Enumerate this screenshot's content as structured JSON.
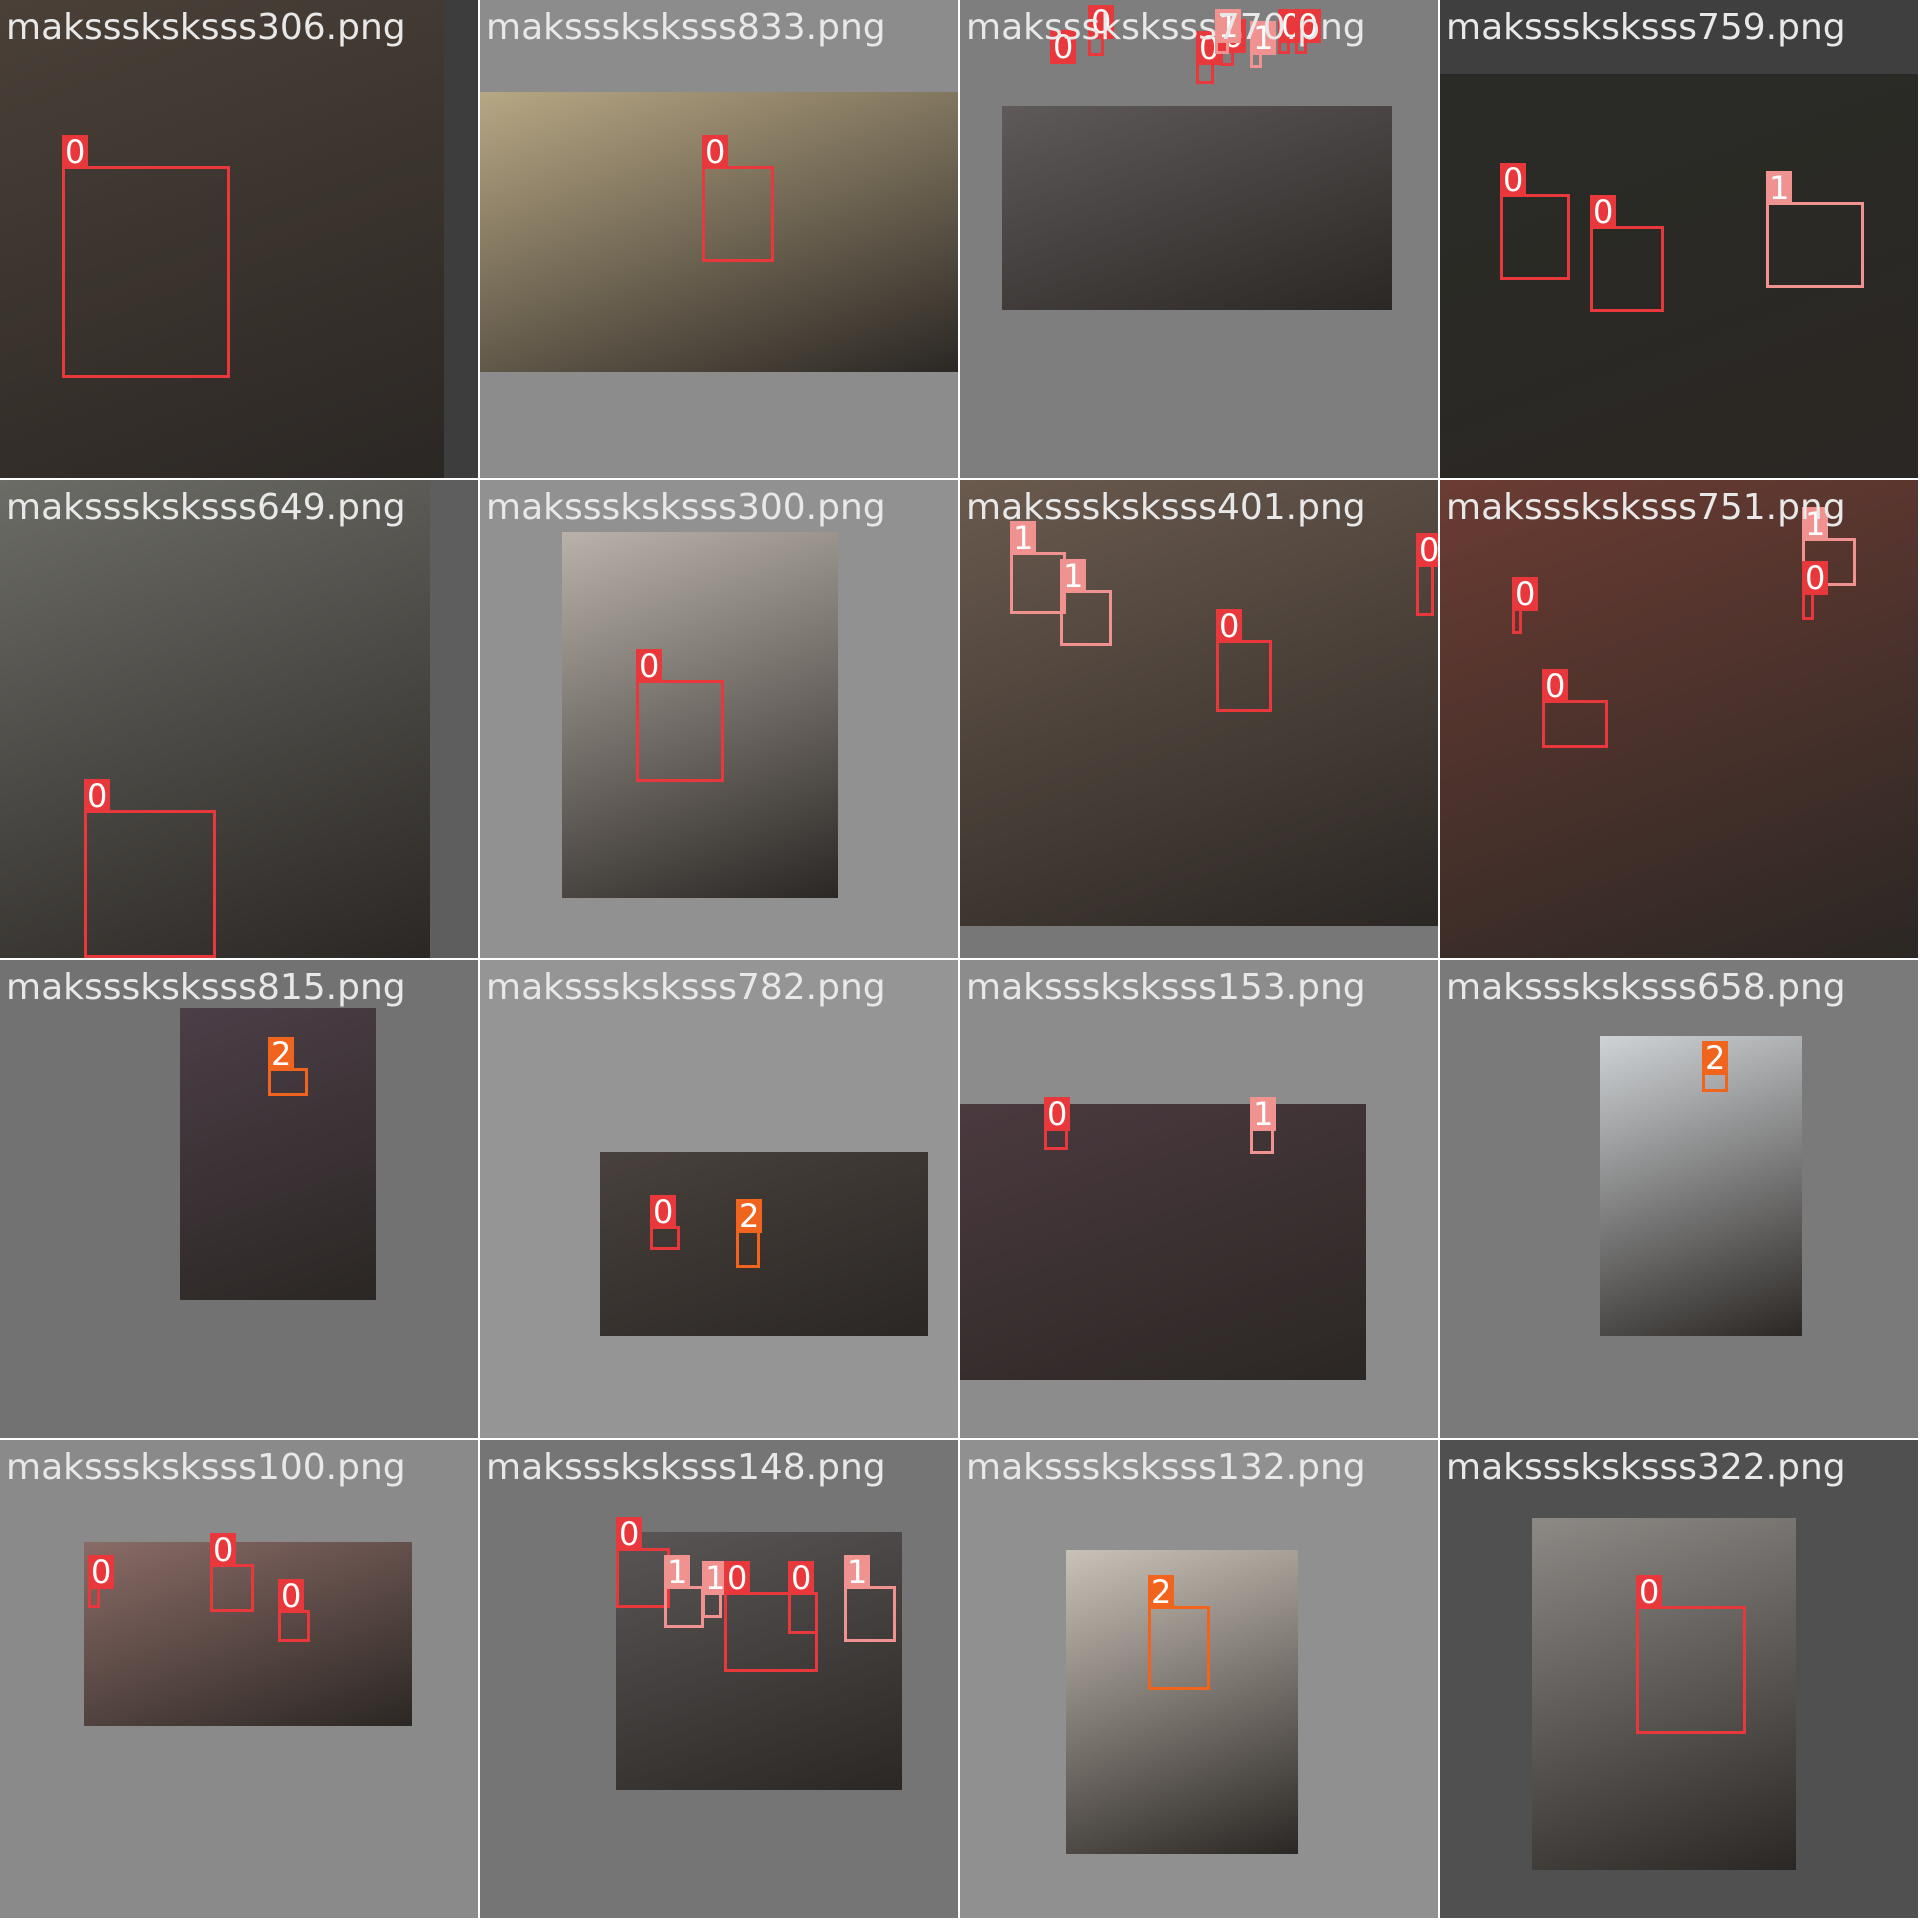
{
  "grid": {
    "columns": 4,
    "rows": 4
  },
  "class_colors": {
    "0": "#e8383b",
    "1": "#f0928f",
    "2": "#f0641e"
  },
  "tiles": [
    {
      "filename": "maksssksksss306.png",
      "bg": "#3d3d3d",
      "photo_color": "#4a4038",
      "boxes": [
        {
          "label": "0"
        }
      ]
    },
    {
      "filename": "maksssksksss833.png",
      "bg": "#8c8c8c",
      "photo_color": "#b7a784",
      "boxes": [
        {
          "label": "0"
        }
      ]
    },
    {
      "filename": "maksssksksss770.png",
      "bg": "#7e7e7e",
      "photo_color": "#5f5a5a",
      "boxes": [
        {
          "label": "0"
        },
        {
          "label": "0"
        },
        {
          "label": "0"
        },
        {
          "label": "0"
        },
        {
          "label": "1"
        },
        {
          "label": "1"
        },
        {
          "label": "0"
        },
        {
          "label": "0"
        }
      ]
    },
    {
      "filename": "maksssksksss759.png",
      "bg": "#3f3f3f",
      "photo_color": "#2a2b26",
      "boxes": [
        {
          "label": "0"
        },
        {
          "label": "0"
        },
        {
          "label": "1"
        }
      ]
    },
    {
      "filename": "maksssksksss649.png",
      "bg": "#5e5e5e",
      "photo_color": "#6c6c66",
      "boxes": [
        {
          "label": "0"
        }
      ]
    },
    {
      "filename": "maksssksksss300.png",
      "bg": "#919191",
      "photo_color": "#b9b2aa",
      "boxes": [
        {
          "label": "0"
        }
      ]
    },
    {
      "filename": "maksssksksss401.png",
      "bg": "#777777",
      "photo_color": "#6a5a4e",
      "boxes": [
        {
          "label": "1"
        },
        {
          "label": "1"
        },
        {
          "label": "0"
        },
        {
          "label": "0"
        }
      ]
    },
    {
      "filename": "maksssksksss751.png",
      "bg": "#4a4a4a",
      "photo_color": "#6b3c33",
      "boxes": [
        {
          "label": "1"
        },
        {
          "label": "0"
        },
        {
          "label": "0"
        },
        {
          "label": "0"
        }
      ]
    },
    {
      "filename": "maksssksksss815.png",
      "bg": "#727272",
      "photo_color": "#4c3e47",
      "boxes": [
        {
          "label": "2"
        }
      ]
    },
    {
      "filename": "maksssksksss782.png",
      "bg": "#959595",
      "photo_color": "#48413d",
      "boxes": [
        {
          "label": "0"
        },
        {
          "label": "2"
        }
      ]
    },
    {
      "filename": "maksssksksss153.png",
      "bg": "#8c8c8c",
      "photo_color": "#4b3a3f",
      "boxes": [
        {
          "label": "0"
        },
        {
          "label": "1"
        }
      ]
    },
    {
      "filename": "maksssksksss658.png",
      "bg": "#7a7a7a",
      "photo_color": "#cfd3d6",
      "boxes": [
        {
          "label": "2"
        }
      ]
    },
    {
      "filename": "maksssksksss100.png",
      "bg": "#8a8a8a",
      "photo_color": "#8a6b66",
      "boxes": [
        {
          "label": "0"
        },
        {
          "label": "0"
        },
        {
          "label": "0"
        }
      ]
    },
    {
      "filename": "maksssksksss148.png",
      "bg": "#757575",
      "photo_color": "#5a5656",
      "boxes": [
        {
          "label": "0"
        },
        {
          "label": "1"
        },
        {
          "label": "1"
        },
        {
          "label": "0"
        },
        {
          "label": "0"
        },
        {
          "label": "1"
        }
      ]
    },
    {
      "filename": "maksssksksss132.png",
      "bg": "#909090",
      "photo_color": "#c9c2b8",
      "boxes": [
        {
          "label": "2"
        }
      ]
    },
    {
      "filename": "maksssksksss322.png",
      "bg": "#505050",
      "photo_color": "#8d8a86",
      "boxes": [
        {
          "label": "0"
        }
      ]
    }
  ]
}
